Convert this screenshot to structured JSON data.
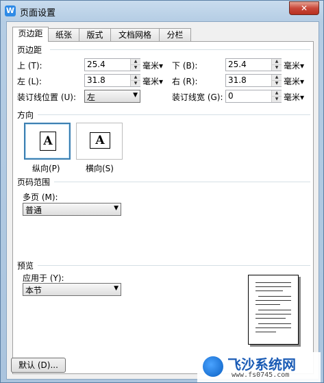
{
  "window": {
    "title": "页面设置",
    "app_icon": "W",
    "close_label": "✕"
  },
  "tabs": [
    {
      "label": "页边距"
    },
    {
      "label": "纸张"
    },
    {
      "label": "版式"
    },
    {
      "label": "文档网格"
    },
    {
      "label": "分栏"
    }
  ],
  "margins": {
    "section": "页边距",
    "top_label": "上 (T):",
    "top_value": "25.4",
    "top_unit": "毫米▾",
    "bottom_label": "下 (B):",
    "bottom_value": "25.4",
    "bottom_unit": "毫米▾",
    "left_label": "左 (L):",
    "left_value": "31.8",
    "left_unit": "毫米▾",
    "right_label": "右 (R):",
    "right_value": "31.8",
    "right_unit": "毫米▾",
    "gutter_pos_label": "装订线位置 (U):",
    "gutter_pos_value": "左",
    "gutter_width_label": "装订线宽 (G):",
    "gutter_width_value": "0",
    "gutter_width_unit": "毫米▾"
  },
  "orientation": {
    "section": "方向",
    "portrait_label": "纵向(P)",
    "landscape_label": "横向(S)",
    "glyph": "A",
    "selected": "portrait"
  },
  "pages": {
    "section": "页码范围",
    "multi_label": "多页 (M):",
    "multi_value": "普通"
  },
  "preview": {
    "section": "预览",
    "apply_label": "应用于 (Y):",
    "apply_value": "本节"
  },
  "buttons": {
    "default_label": "默认 (D)..."
  },
  "watermark": {
    "text": "飞沙系统网",
    "url": "www.fs0745.com"
  }
}
